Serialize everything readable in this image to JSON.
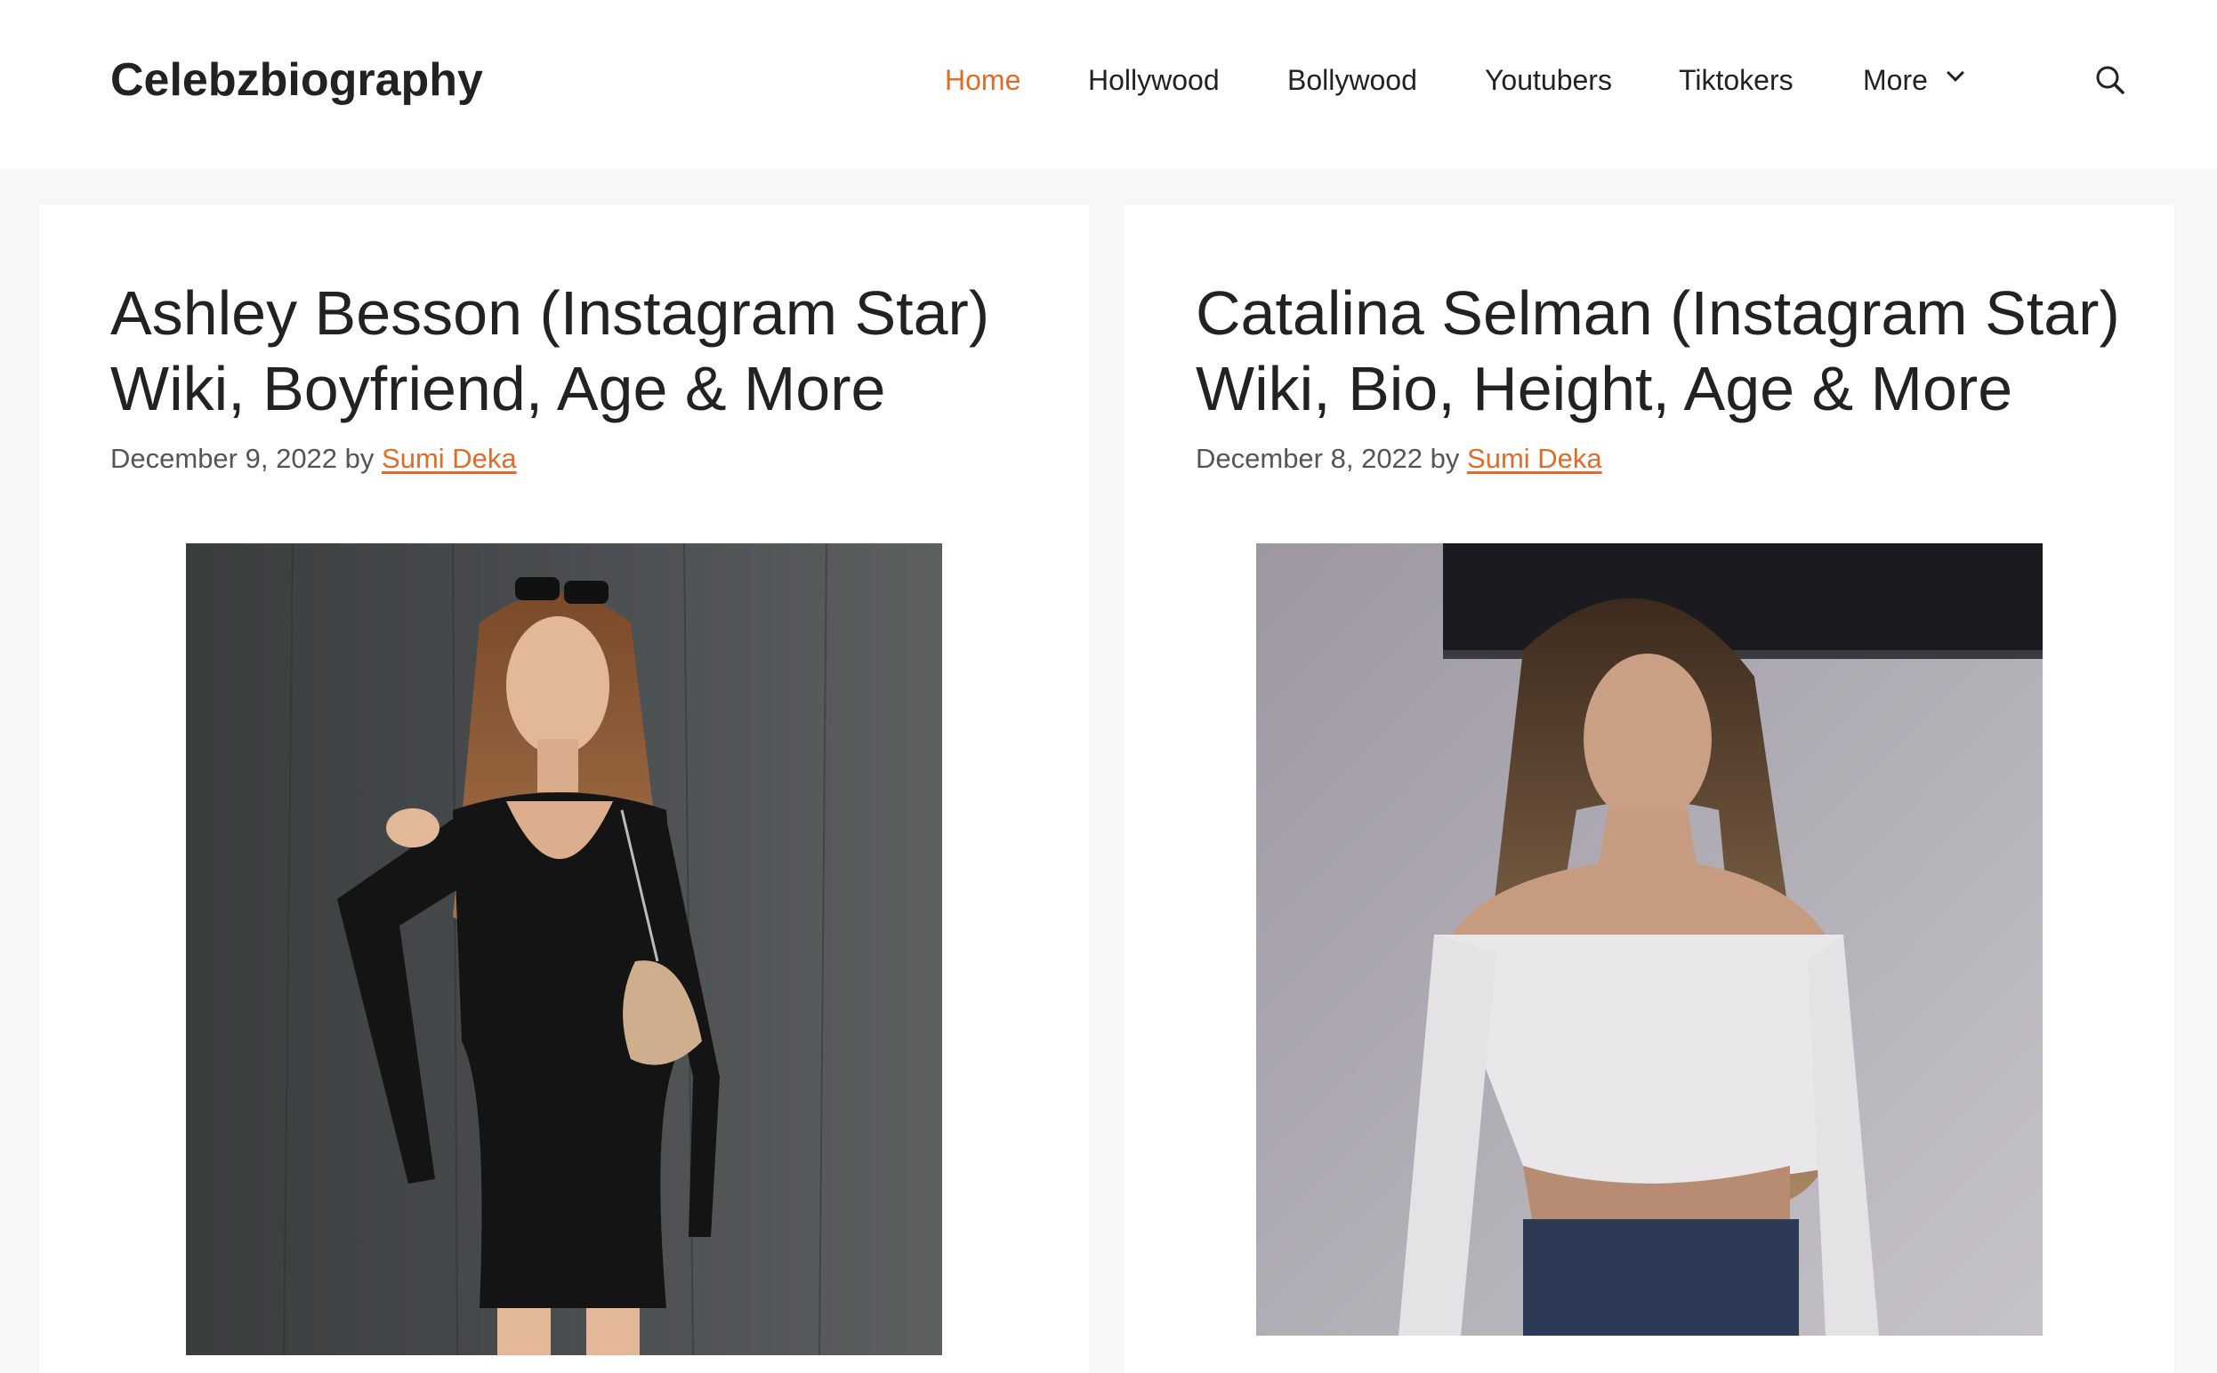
{
  "site": {
    "title": "Celebzbiography"
  },
  "nav": {
    "items": [
      {
        "label": "Home",
        "active": true
      },
      {
        "label": "Hollywood",
        "active": false
      },
      {
        "label": "Bollywood",
        "active": false
      },
      {
        "label": "Youtubers",
        "active": false
      },
      {
        "label": "Tiktokers",
        "active": false
      },
      {
        "label": "More",
        "active": false,
        "icon": "chevron-down-icon"
      }
    ],
    "search_icon": "search-icon",
    "accent_color": "#e06c2b"
  },
  "posts": [
    {
      "title_line1": "Ashley Besson (Instagram Star)",
      "title_line2": "Wiki, Boyfriend, Age & More",
      "date": "December 9, 2022",
      "by": "by",
      "author": "Sumi Deka",
      "image_alt": "Ashley Besson"
    },
    {
      "title_line1": "Catalina Selman (Instagram Star)",
      "title_line2": "Wiki, Bio, Height, Age & More",
      "date": "December 8, 2022",
      "by": "by",
      "author": "Sumi Deka",
      "image_alt": "Catalina Selman"
    }
  ]
}
